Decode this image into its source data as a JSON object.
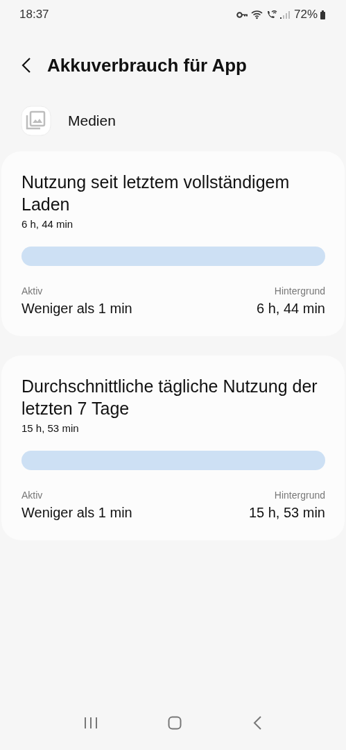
{
  "status_bar": {
    "time": "18:37",
    "battery": "72%"
  },
  "header": {
    "title": "Akkuverbrauch für App"
  },
  "app": {
    "name": "Medien"
  },
  "cards": [
    {
      "title": "Nutzung seit letztem vollständigem Laden",
      "total": "6 h, 44 min",
      "active_label": "Aktiv",
      "active_value": "Weniger als 1 min",
      "background_label": "Hintergrund",
      "background_value": "6 h, 44 min"
    },
    {
      "title": "Durchschnittliche tägliche Nutzung der letzten 7 Tage",
      "total": "15 h, 53 min",
      "active_label": "Aktiv",
      "active_value": "Weniger als 1 min",
      "background_label": "Hintergrund",
      "background_value": "15 h, 53 min"
    }
  ]
}
